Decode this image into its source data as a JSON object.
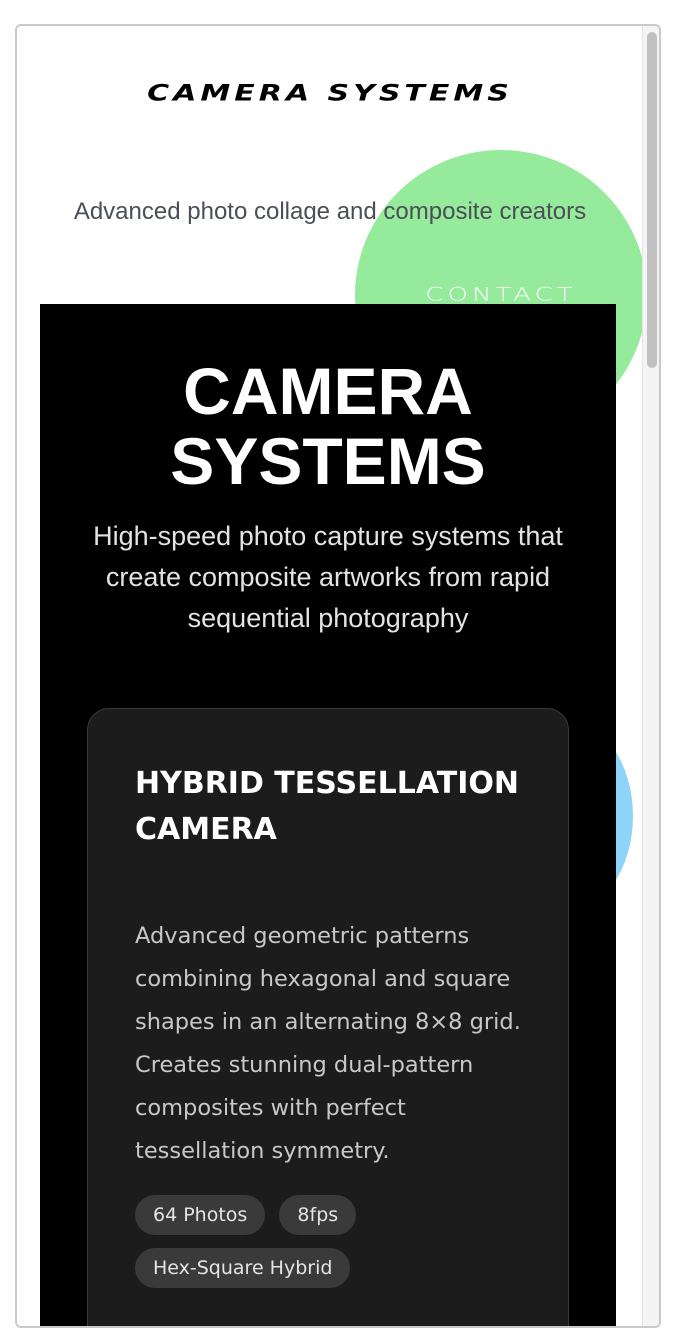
{
  "header": {
    "logo_text": "CAMERA SYSTEMS",
    "tagline": "Advanced photo collage and composite creators",
    "contact_label": "CONTACT"
  },
  "hero": {
    "title_line1": "CAMERA",
    "title_line2": "SYSTEMS",
    "subtitle": "High-speed photo capture systems that create composite artworks from rapid sequential photography"
  },
  "products": [
    {
      "title": "HYBRID TESSELLATION CAMERA",
      "description": "Advanced geometric patterns combining hexagonal and square shapes in an alternating 8×8 grid. Creates stunning dual-pattern composites with perfect tessellation symmetry.",
      "tags": [
        "64 Photos",
        "8fps",
        "Hex-Square Hybrid"
      ]
    }
  ],
  "colors": {
    "accent_green": "#96ea9b",
    "accent_blue": "#8fd3f7",
    "hero_bg": "#000000",
    "card_bg": "#1c1c1c",
    "tag_bg": "#3a3a3a"
  }
}
